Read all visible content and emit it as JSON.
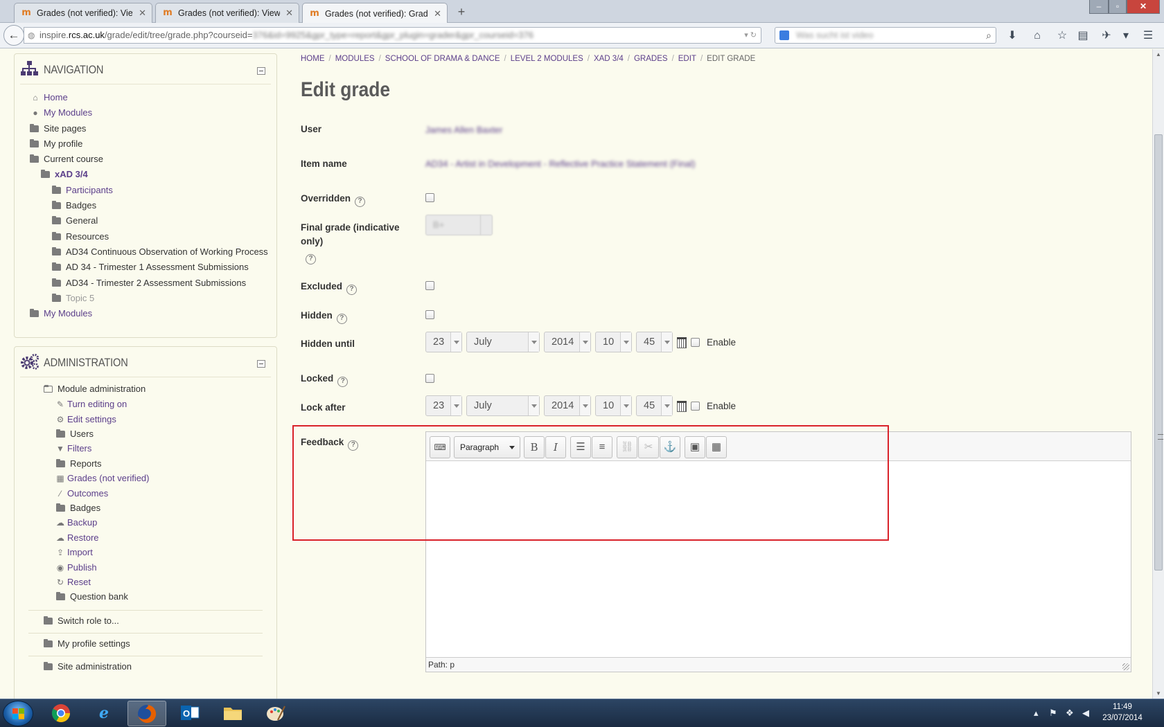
{
  "browser": {
    "tabs": [
      {
        "title": "Grades (not verified): View",
        "active": false
      },
      {
        "title": "Grades (not verified): View",
        "active": false
      },
      {
        "title": "Grades (not verified): Grad...",
        "active": true
      }
    ],
    "url": {
      "prefix": "inspire.",
      "domain": "rcs.ac.uk",
      "path": "/grade/edit/tree/grade.php?courseid=",
      "obscured_rest": "376&id=9925&gpr_type=report&gpr_plugin=grader&gpr_courseid=376"
    },
    "search_placeholder": "Was sucht ist video"
  },
  "navigation": {
    "title": "NAVIGATION",
    "items": [
      {
        "label": "Home",
        "icon": "home-icon",
        "level": 1,
        "style": "link"
      },
      {
        "label": "My Modules",
        "icon": "circle-icon",
        "level": 1,
        "style": "link"
      },
      {
        "label": "Site pages",
        "icon": "folder-icon",
        "level": 1,
        "style": "text"
      },
      {
        "label": "My profile",
        "icon": "folder-icon",
        "level": 1,
        "style": "text"
      },
      {
        "label": "Current course",
        "icon": "folder-icon",
        "level": 1,
        "style": "text"
      },
      {
        "label": "xAD 3/4",
        "icon": "folder-icon",
        "level": 2,
        "style": "bold"
      },
      {
        "label": "Participants",
        "icon": "folder-icon",
        "level": 3,
        "style": "link"
      },
      {
        "label": "Badges",
        "icon": "folder-icon",
        "level": 3,
        "style": "text"
      },
      {
        "label": "General",
        "icon": "folder-icon",
        "level": 3,
        "style": "text"
      },
      {
        "label": "Resources",
        "icon": "folder-icon",
        "level": 3,
        "style": "text"
      },
      {
        "label": "AD34 Continuous Observation of Working Process",
        "icon": "folder-icon",
        "level": 3,
        "style": "text"
      },
      {
        "label": "AD 34 - Trimester 1 Assessment Submissions",
        "icon": "folder-icon",
        "level": 3,
        "style": "text"
      },
      {
        "label": "AD34 - Trimester 2 Assessment Submissions",
        "icon": "folder-icon",
        "level": 3,
        "style": "text"
      },
      {
        "label": "Topic 5",
        "icon": "folder-icon",
        "level": 3,
        "style": "dim"
      },
      {
        "label": "My Modules",
        "icon": "folder-icon",
        "level": 1,
        "style": "link"
      }
    ]
  },
  "administration": {
    "title": "ADMINISTRATION",
    "module_admin_label": "Module administration",
    "items": [
      {
        "label": "Turn editing on",
        "icon": "pencil-icon"
      },
      {
        "label": "Edit settings",
        "icon": "gears-icon"
      },
      {
        "label": "Users",
        "icon": "folder-icon"
      },
      {
        "label": "Filters",
        "icon": "filter-icon"
      },
      {
        "label": "Reports",
        "icon": "folder-icon"
      },
      {
        "label": "Grades (not verified)",
        "icon": "table-icon"
      },
      {
        "label": "Outcomes",
        "icon": "wand-icon"
      },
      {
        "label": "Badges",
        "icon": "folder-icon"
      },
      {
        "label": "Backup",
        "icon": "cloud-upload-icon"
      },
      {
        "label": "Restore",
        "icon": "cloud-download-icon"
      },
      {
        "label": "Import",
        "icon": "import-icon"
      },
      {
        "label": "Publish",
        "icon": "globe-icon"
      },
      {
        "label": "Reset",
        "icon": "reset-icon"
      },
      {
        "label": "Question bank",
        "icon": "folder-icon"
      }
    ],
    "extra": [
      "Switch role to...",
      "My profile settings",
      "Site administration"
    ]
  },
  "breadcrumb": [
    "HOME",
    "MODULES",
    "SCHOOL OF DRAMA & DANCE",
    "LEVEL 2 MODULES",
    "XAD 3/4",
    "GRADES",
    "EDIT",
    "EDIT GRADE"
  ],
  "form": {
    "title": "Edit grade",
    "user_label": "User",
    "user_value": "James Allen Baxter",
    "item_label": "Item name",
    "item_value": "AD34 - Artist in Development - Reflective Practice Statement (Final)",
    "overridden_label": "Overridden",
    "final_grade_label_1": "Final grade (indicative",
    "final_grade_label_2": "only)",
    "final_grade_value": "B+",
    "excluded_label": "Excluded",
    "hidden_label": "Hidden",
    "hidden_until_label": "Hidden until",
    "locked_label": "Locked",
    "lock_after_label": "Lock after",
    "date": {
      "day": "23",
      "month": "July",
      "year": "2014",
      "hour": "10",
      "minute": "45"
    },
    "enable_label": "Enable",
    "feedback_label": "Feedback",
    "editor": {
      "format": "Paragraph",
      "path": "Path: p"
    }
  },
  "taskbar": {
    "time": "11:49",
    "date": "23/07/2014"
  },
  "colors": {
    "link": "#5b3e8a",
    "page_bg": "#fbfbee",
    "highlight": "#d9222a"
  }
}
